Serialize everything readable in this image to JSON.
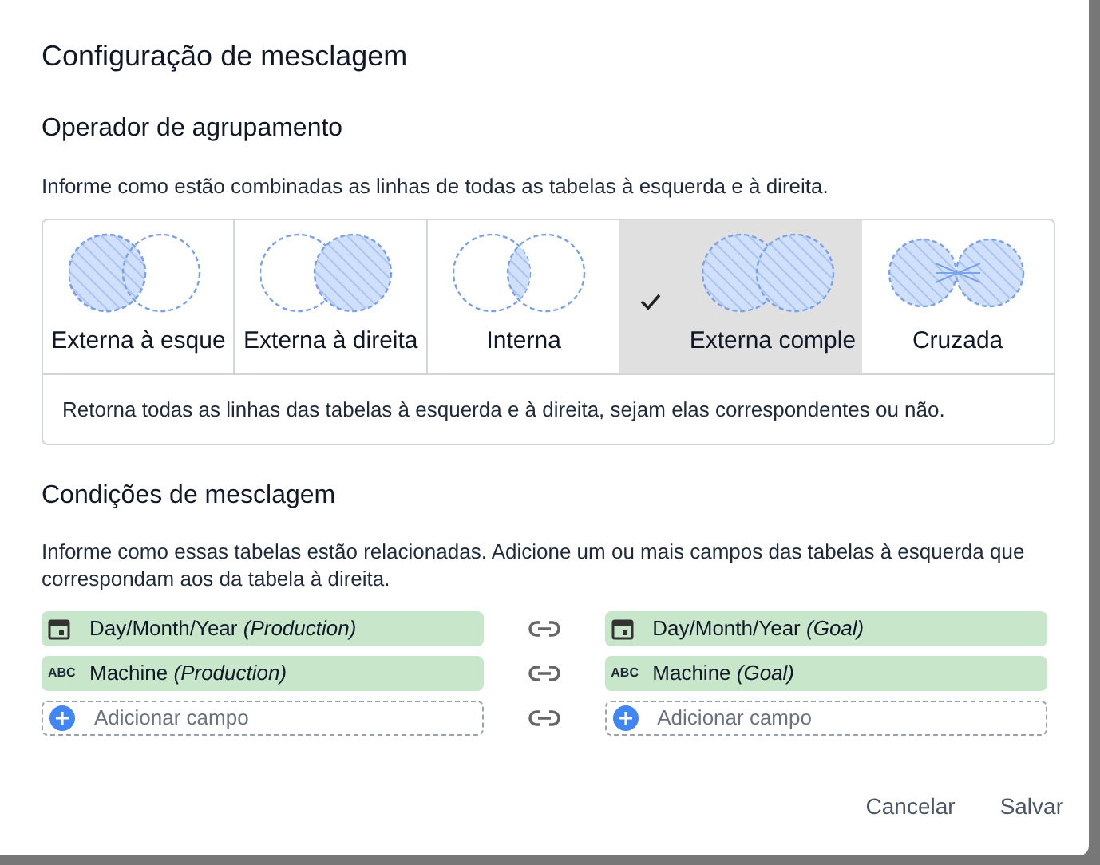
{
  "dialog": {
    "title": "Configuração de mesclagem"
  },
  "join_operator": {
    "heading": "Operador de agrupamento",
    "description": "Informe como estão combinadas as linhas de todas as tabelas à esquerda e à direita.",
    "options": [
      {
        "kind": "left",
        "label": "Externa à esque",
        "selected": false
      },
      {
        "kind": "right",
        "label": "Externa à direita",
        "selected": false
      },
      {
        "kind": "inner",
        "label": "Interna",
        "selected": false
      },
      {
        "kind": "full",
        "label": "Externa comple",
        "selected": true
      },
      {
        "kind": "cross",
        "label": "Cruzada",
        "selected": false
      }
    ],
    "selected_description": "Retorna todas as linhas das tabelas à esquerda e à direita, sejam elas correspondentes ou não."
  },
  "join_conditions": {
    "heading": "Condições de mesclagem",
    "description": "Informe como essas tabelas estão relacionadas. Adicione um ou mais campos das tabelas à esquerda que correspondam aos da tabela à direita.",
    "rows": [
      {
        "left": {
          "kind": "date",
          "label": "Day/Month/Year *(Production)*"
        },
        "right": {
          "kind": "date",
          "label": "Day/Month/Year *(Goal)*"
        }
      },
      {
        "left": {
          "kind": "text",
          "label": "Machine *(Production)*",
          "type_icon": "ABC"
        },
        "right": {
          "kind": "text",
          "label": "Machine *(Goal)*",
          "type_icon": "ABC"
        }
      },
      {
        "left": {
          "kind": "add",
          "label": "Adicionar campo"
        },
        "right": {
          "kind": "add",
          "label": "Adicionar campo"
        }
      }
    ]
  },
  "buttons": [
    "Cancelar",
    "Salvar"
  ]
}
